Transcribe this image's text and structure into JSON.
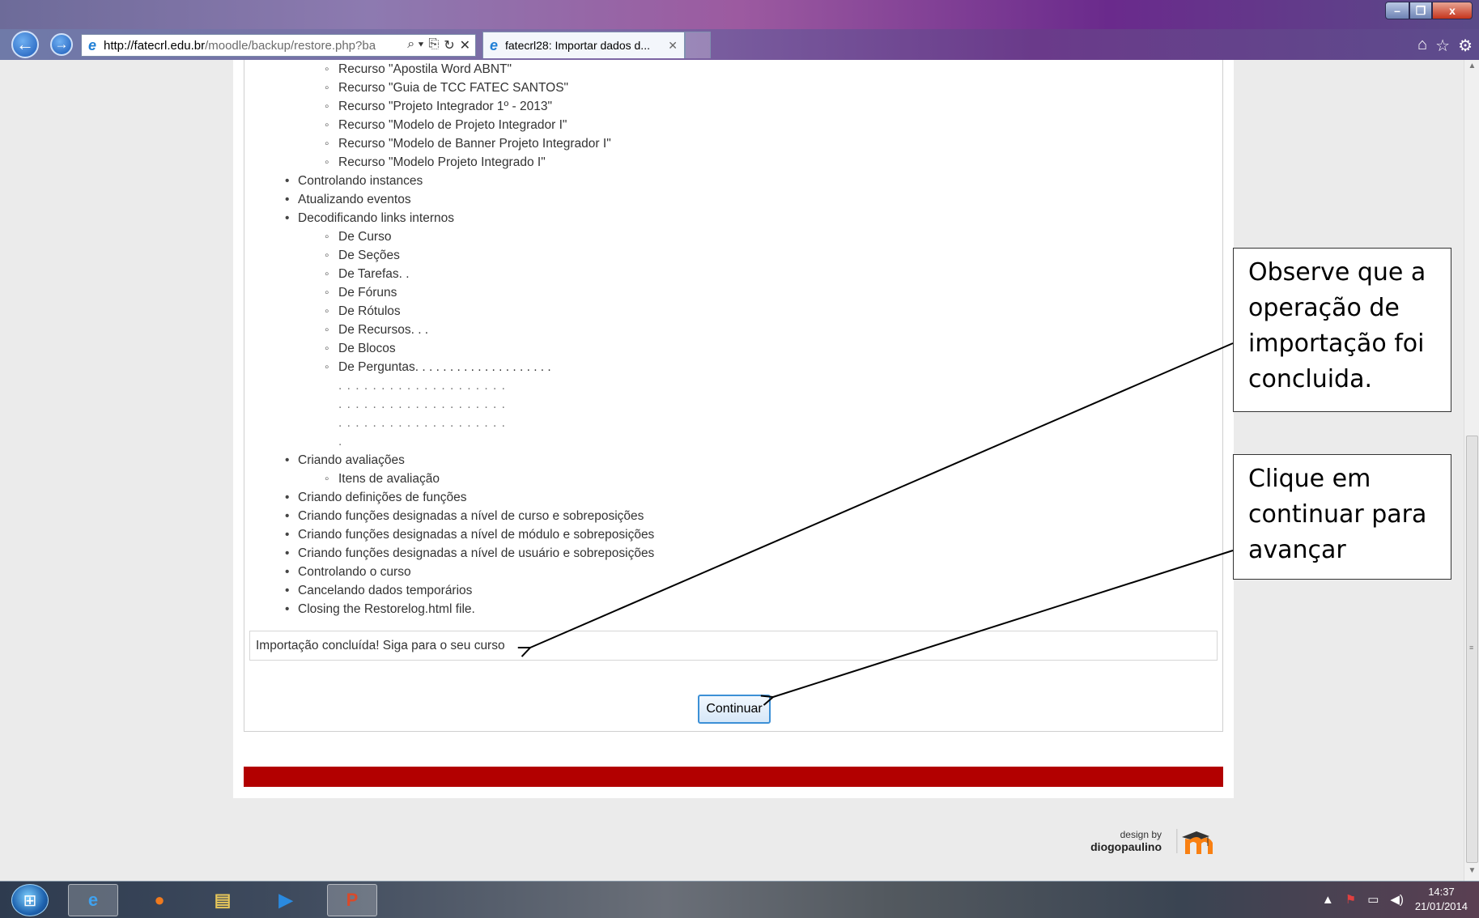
{
  "window": {
    "minimize": "–",
    "maximize": "❐",
    "close": "x"
  },
  "browser": {
    "url_host": "http://fatecrl.edu.br",
    "url_path": "/moodle/backup/restore.php?ba",
    "addr_tools": [
      "⌕ ▾",
      "⎘",
      "↻",
      "✕"
    ],
    "tab_title": "fatecrl28: Importar dados d...",
    "tab_close": "✕",
    "right_icons": [
      "home-icon",
      "star-icon",
      "gear-icon"
    ]
  },
  "log": {
    "items": [
      {
        "level": 2,
        "text": "Recurso \"Apostila Word ABNT\""
      },
      {
        "level": 2,
        "text": "Recurso \"Guia de TCC FATEC SANTOS\""
      },
      {
        "level": 2,
        "text": "Recurso \"Projeto Integrador 1º - 2013\""
      },
      {
        "level": 2,
        "text": "Recurso \"Modelo de Projeto Integrador I\""
      },
      {
        "level": 2,
        "text": "Recurso \"Modelo de Banner Projeto Integrador I\""
      },
      {
        "level": 2,
        "text": "Recurso \"Modelo Projeto Integrado I\""
      },
      {
        "level": 1,
        "text": "Controlando instances"
      },
      {
        "level": 1,
        "text": "Atualizando eventos"
      },
      {
        "level": 1,
        "text": "Decodificando links internos"
      },
      {
        "level": 2,
        "text": "De Curso"
      },
      {
        "level": 2,
        "text": "De Seções"
      },
      {
        "level": 2,
        "text": "De Tarefas. ."
      },
      {
        "level": 2,
        "text": "De Fóruns"
      },
      {
        "level": 2,
        "text": "De Rótulos"
      },
      {
        "level": 2,
        "text": "De Recursos. . ."
      },
      {
        "level": 2,
        "text": "De Blocos"
      },
      {
        "level": 2,
        "text": "De Perguntas. . . . . . . . . . . . . . . . . . . ."
      },
      {
        "level": 3,
        "text": ". . . . . . . . . . . . . . . . . . . ."
      },
      {
        "level": 3,
        "text": ". . . . . . . . . . . . . . . . . . . ."
      },
      {
        "level": 3,
        "text": ". . . . . . . . . . . . . . . . . . . ."
      },
      {
        "level": 3,
        "text": "."
      },
      {
        "level": 1,
        "text": "Criando avaliações"
      },
      {
        "level": 2,
        "text": "Itens de avaliação"
      },
      {
        "level": 1,
        "text": "Criando definições de funções"
      },
      {
        "level": 1,
        "text": "Criando funções designadas a nível de curso e sobreposições"
      },
      {
        "level": 1,
        "text": "Criando funções designadas a nível de módulo e sobreposições"
      },
      {
        "level": 1,
        "text": "Criando funções designadas a nível de usuário e sobreposições"
      },
      {
        "level": 1,
        "text": "Controlando o curso"
      },
      {
        "level": 1,
        "text": "Cancelando dados temporários"
      },
      {
        "level": 1,
        "text": "Closing the Restorelog.html file."
      }
    ],
    "done_message": "Importação concluída! Siga para o seu curso",
    "continue_label": "Continuar"
  },
  "footer": {
    "design_by": "design by",
    "author": "diogopaulino",
    "logo": "moodle-logo",
    "bar_color": "#b20000"
  },
  "callouts": {
    "first": "Observe que a operação de importação foi concluida.",
    "second": "Clique em continuar para avançar"
  },
  "taskbar": {
    "apps": [
      "internet-explorer-icon",
      "firefox-icon",
      "file-explorer-icon",
      "media-player-icon",
      "powerpoint-icon"
    ],
    "clock_time": "14:37",
    "clock_date": "21/01/2014"
  }
}
